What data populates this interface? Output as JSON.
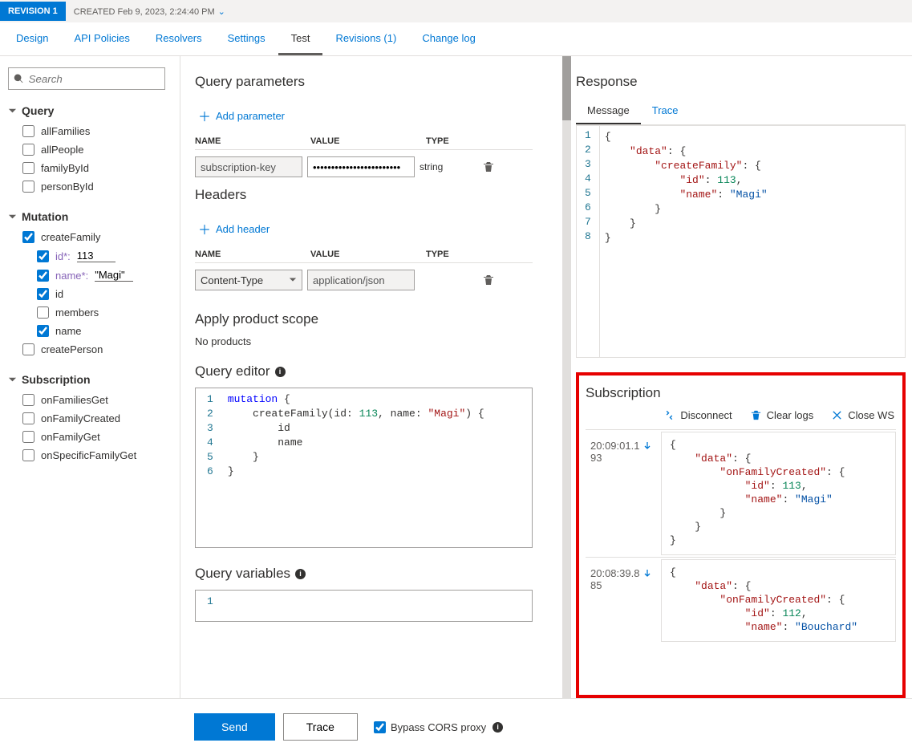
{
  "revision": {
    "badge": "REVISION 1",
    "created": "CREATED Feb 9, 2023, 2:24:40 PM"
  },
  "tabs": [
    "Design",
    "API Policies",
    "Resolvers",
    "Settings",
    "Test",
    "Revisions (1)",
    "Change log"
  ],
  "active_tab": 4,
  "search_placeholder": "Search",
  "sidebar": {
    "query": {
      "title": "Query",
      "items": [
        {
          "label": "allFamilies",
          "checked": false
        },
        {
          "label": "allPeople",
          "checked": false
        },
        {
          "label": "familyById",
          "checked": false
        },
        {
          "label": "personById",
          "checked": false
        }
      ]
    },
    "mutation": {
      "title": "Mutation",
      "items": [
        {
          "label": "createFamily",
          "checked": true,
          "params": [
            {
              "name": "id*:",
              "value": "113",
              "checked": true
            },
            {
              "name": "name*:",
              "value": "\"Magi\"",
              "checked": true
            }
          ],
          "fields": [
            {
              "label": "id",
              "checked": true
            },
            {
              "label": "members",
              "checked": false
            },
            {
              "label": "name",
              "checked": true
            }
          ]
        },
        {
          "label": "createPerson",
          "checked": false
        }
      ]
    },
    "subscription": {
      "title": "Subscription",
      "items": [
        {
          "label": "onFamiliesGet",
          "checked": false
        },
        {
          "label": "onFamilyCreated",
          "checked": false
        },
        {
          "label": "onFamilyGet",
          "checked": false
        },
        {
          "label": "onSpecificFamilyGet",
          "checked": false
        }
      ]
    }
  },
  "center": {
    "query_params": {
      "title": "Query parameters",
      "add": "Add parameter",
      "cols": [
        "NAME",
        "VALUE",
        "TYPE"
      ],
      "rows": [
        {
          "name": "subscription-key",
          "value": "••••••••••••••••••••••••",
          "type": "string"
        }
      ]
    },
    "headers": {
      "title": "Headers",
      "add": "Add header",
      "cols": [
        "NAME",
        "VALUE",
        "TYPE"
      ],
      "rows": [
        {
          "name": "Content-Type",
          "value": "application/json",
          "type": ""
        }
      ]
    },
    "scope": {
      "title": "Apply product scope",
      "msg": "No products"
    },
    "editor": {
      "title": "Query editor",
      "lines": [
        "mutation {",
        "    createFamily(id: 113, name: \"Magi\") {",
        "        id",
        "        name",
        "    }",
        "}"
      ]
    },
    "vars": {
      "title": "Query variables",
      "lines": [
        ""
      ]
    }
  },
  "response": {
    "title": "Response",
    "tabs": [
      "Message",
      "Trace"
    ],
    "json": {
      "data": {
        "createFamily": {
          "id": 113,
          "name": "Magi"
        }
      }
    }
  },
  "subscription": {
    "title": "Subscription",
    "tools": {
      "disconnect": "Disconnect",
      "clear": "Clear logs",
      "close": "Close WS"
    },
    "logs": [
      {
        "ts": "20:09:01.193",
        "json": {
          "data": {
            "onFamilyCreated": {
              "id": 113,
              "name": "Magi"
            }
          }
        }
      },
      {
        "ts": "20:08:39.885",
        "json": {
          "data": {
            "onFamilyCreated": {
              "id": 112,
              "name": "Bouchard"
            }
          }
        },
        "truncated": true
      }
    ]
  },
  "footer": {
    "send": "Send",
    "trace": "Trace",
    "bypass": "Bypass CORS proxy"
  }
}
